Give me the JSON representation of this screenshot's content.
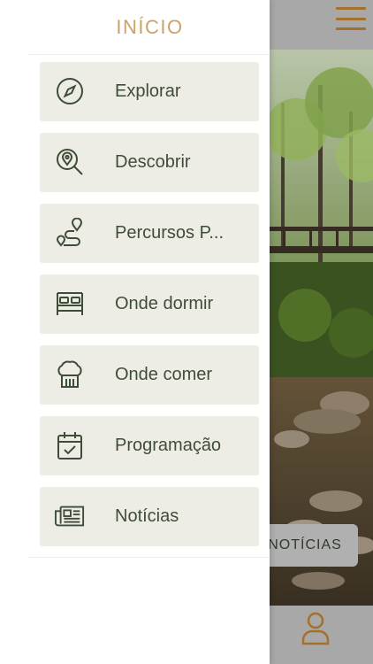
{
  "drawer": {
    "title": "INÍCIO",
    "items": [
      {
        "label": "Explorar",
        "icon": "compass-icon"
      },
      {
        "label": "Descobrir",
        "icon": "map-search-icon"
      },
      {
        "label": "Percursos P...",
        "icon": "route-icon"
      },
      {
        "label": "Onde dormir",
        "icon": "bed-icon"
      },
      {
        "label": "Onde comer",
        "icon": "chef-hat-icon"
      },
      {
        "label": "Programação",
        "icon": "calendar-check-icon"
      },
      {
        "label": "Notícias",
        "icon": "newspaper-icon"
      }
    ]
  },
  "background": {
    "news_button_label": "NOTÍCIAS",
    "menu_icon": "hamburger-icon",
    "profile_icon": "user-icon"
  },
  "colors": {
    "accent": "#cda16a",
    "menu_item_bg": "#eeede5",
    "menu_text": "#3d4d37",
    "hamburger": "#a56f2c"
  }
}
